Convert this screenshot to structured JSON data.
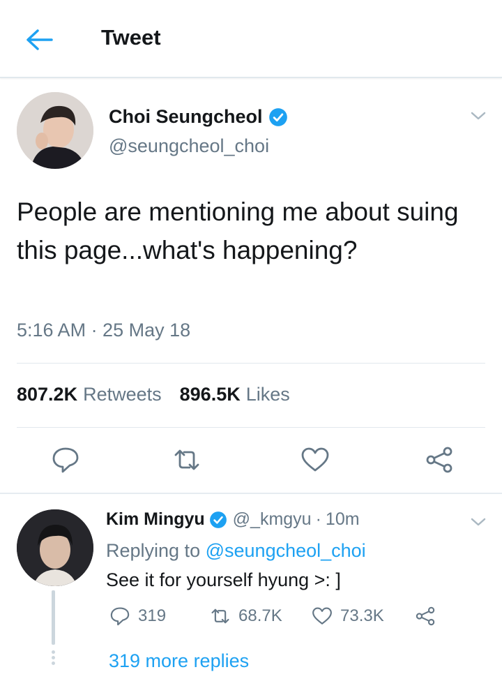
{
  "header": {
    "title": "Tweet",
    "back_icon": "arrow-left-icon"
  },
  "colors": {
    "accent": "#1da1f2",
    "secondary_text": "#657786",
    "primary_text": "#14171a",
    "divider": "#e1e8ed"
  },
  "tweet": {
    "author_name": "Choi Seungcheol",
    "handle": "@seungcheol_choi",
    "verified": true,
    "text": "People are mentioning me about suing this page...what's happening?",
    "timestamp": "5:16 AM · 25 May 18",
    "retweets_count": "807.2K",
    "retweets_label": "Retweets",
    "likes_count": "896.5K",
    "likes_label": "Likes",
    "actions": [
      "reply-icon",
      "retweet-icon",
      "like-icon",
      "share-icon"
    ]
  },
  "reply": {
    "author_name": "Kim Mingyu",
    "handle": "@_kmgyu",
    "separator": "·",
    "time": "10m",
    "verified": true,
    "replying_prefix": "Replying to",
    "replying_to": "@seungcheol_choi",
    "text": "See it for yourself hyung >: ]",
    "reply_count": "319",
    "retweet_count": "68.7K",
    "like_count": "73.3K",
    "more_replies": "319 more replies"
  }
}
